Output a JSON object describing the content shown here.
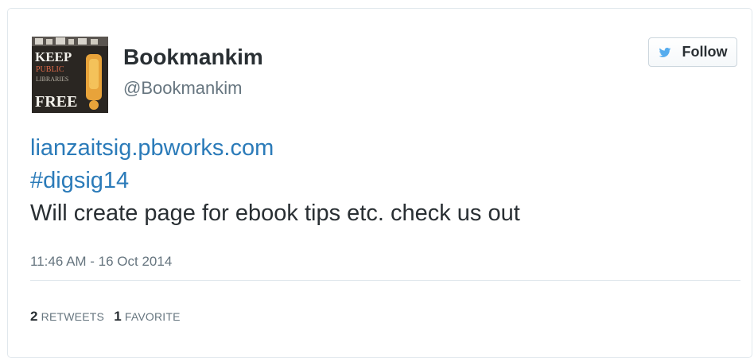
{
  "author": {
    "name": "Bookmankim",
    "handle": "@Bookmankim",
    "avatar_text": [
      "KEEP",
      "PUBLIC",
      "LIBRARIES",
      "FREE",
      "!"
    ]
  },
  "follow_button": {
    "label": "Follow"
  },
  "tweet": {
    "link": "lianzaitsig.pbworks.com",
    "hashtag": "#digsig14",
    "text": "Will create page for ebook tips etc. check us out"
  },
  "timestamp": "11:46 AM - 16 Oct 2014",
  "stats": {
    "retweets_count": "2",
    "retweets_label": "RETWEETS",
    "favorites_count": "1",
    "favorites_label": "FAVORITE"
  },
  "colors": {
    "link": "#2b7bb9",
    "text": "#292f33",
    "muted": "#66757f",
    "border": "#e1e8ed",
    "avatar_exclaim": "#e8a33a"
  },
  "icons": {
    "follow": "twitter-bird-icon"
  }
}
